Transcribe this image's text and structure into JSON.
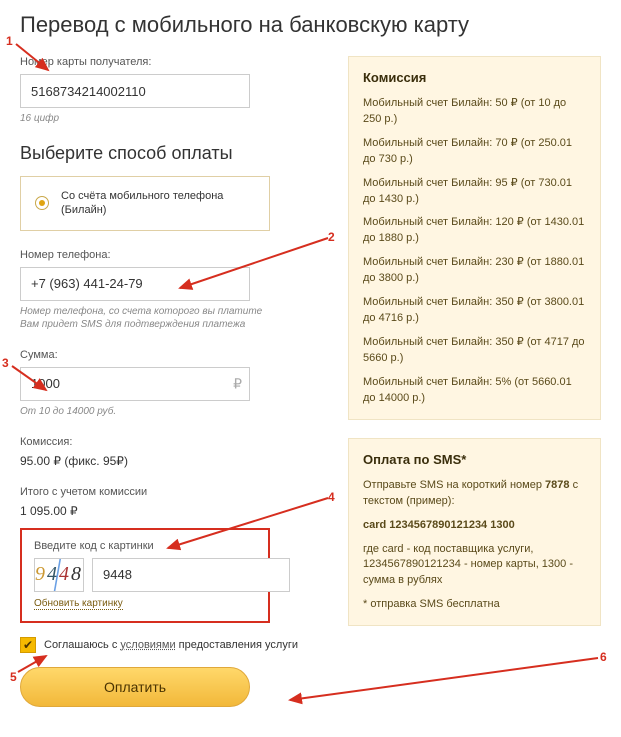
{
  "page": {
    "title": "Перевод с мобильного на банковскую карту"
  },
  "card": {
    "label": "Номер карты получателя:",
    "value": "5168734214002110",
    "hint": "16 цифр"
  },
  "paymethod": {
    "heading": "Выберите способ оплаты",
    "option_line1": "Со счёта мобильного телефона",
    "option_line2": "(Билайн)"
  },
  "phone": {
    "label": "Номер телефона:",
    "value": "+7 (963) 441-24-79",
    "hint1": "Номер телефона, со счета которого вы платите",
    "hint2": "Вам придет SMS для подтверждения платежа"
  },
  "sum": {
    "label": "Сумма:",
    "value": "1000",
    "currency": "₽",
    "hint": "От 10 до 14000 руб."
  },
  "fee": {
    "label": "Комиссия:",
    "value": "95.00 ₽ (фикс. 95₽)"
  },
  "total": {
    "label": "Итого с учетом комиссии",
    "value": "1 095.00 ₽"
  },
  "captcha": {
    "label": "Введите код с картинки",
    "image_chars": [
      "9",
      "4",
      "4",
      "8"
    ],
    "input_value": "9448",
    "refresh": "Обновить картинку"
  },
  "agree": {
    "text_before": "Соглашаюсь с ",
    "link": "условиями",
    "text_after": " предоставления услуги"
  },
  "submit": {
    "label": "Оплатить"
  },
  "commission_panel": {
    "title": "Комиссия",
    "rows": [
      "Мобильный счет Билайн: 50 ₽ (от 10 до 250 р.)",
      "Мобильный счет Билайн: 70 ₽ (от 250.01 до 730 р.)",
      "Мобильный счет Билайн: 95 ₽ (от 730.01 до 1430 р.)",
      "Мобильный счет Билайн: 120 ₽ (от 1430.01 до 1880 р.)",
      "Мобильный счет Билайн: 230 ₽ (от 1880.01 до 3800 р.)",
      "Мобильный счет Билайн: 350 ₽ (от 3800.01 до 4716 р.)",
      "Мобильный счет Билайн: 350 ₽ (от 4717 до 5660 р.)",
      "Мобильный счет Билайн: 5% (от 5660.01 до 14000 р.)"
    ]
  },
  "sms_panel": {
    "title": "Оплата по SMS*",
    "p1a": "Отправьте SMS на короткий номер ",
    "p1b": "7878",
    "p1c": " с текстом (пример):",
    "example": "card 1234567890121234 1300",
    "p2": "где card - код поставщика услуги, 1234567890121234 - номер карты, 1300 - сумма в рублях",
    "p3": "* отправка SMS бесплатна"
  },
  "annotations": {
    "1": "1",
    "2": "2",
    "3": "3",
    "4": "4",
    "5": "5",
    "6": "6"
  }
}
